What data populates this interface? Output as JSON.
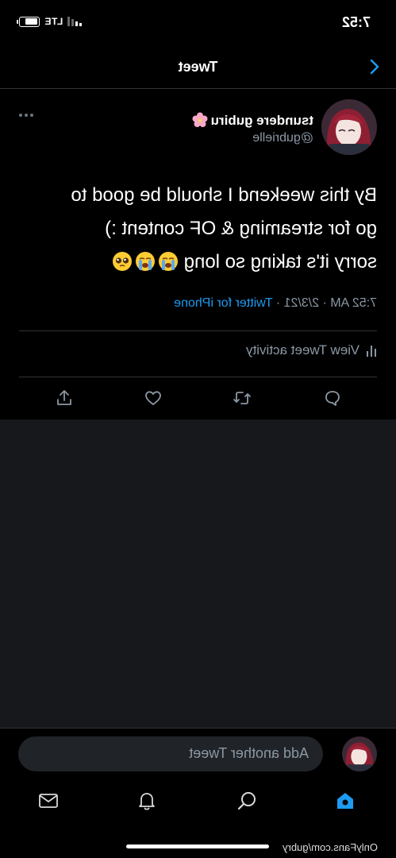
{
  "status_bar": {
    "time": "7:52",
    "network": "LTE",
    "battery_percent": 75
  },
  "nav": {
    "title": "Tweet",
    "back_icon": "chevron-left-icon"
  },
  "tweet": {
    "author_name": "tsundere gubiru",
    "author_name_emoji": "cherry-blossom",
    "author_handle": "@gubrielle",
    "text_line1": "By this weekend I should be good to",
    "text_line2": "go for streaming & OF content :)",
    "text_line3": "sorry it's taking so long",
    "text_emojis": [
      "loudly-crying-face",
      "loudly-crying-face",
      "pleading-face"
    ],
    "time": "7:52 AM",
    "date": "2/3/21",
    "separator": "·",
    "source": "Twitter for iPhone",
    "activity_label": "View Tweet activity",
    "actions": [
      "reply-icon",
      "retweet-icon",
      "like-icon",
      "share-icon"
    ]
  },
  "reply_bar": {
    "placeholder": "Add another Tweet"
  },
  "tab_bar": {
    "items": [
      "home-icon",
      "search-icon",
      "notifications-icon",
      "messages-icon"
    ],
    "active": "home-icon"
  },
  "watermark": "OnlyFans.com/gubry",
  "colors": {
    "background": "#000000",
    "link": "#1d9bf0",
    "muted": "#8b98a5",
    "empty_area": "#16181c"
  }
}
